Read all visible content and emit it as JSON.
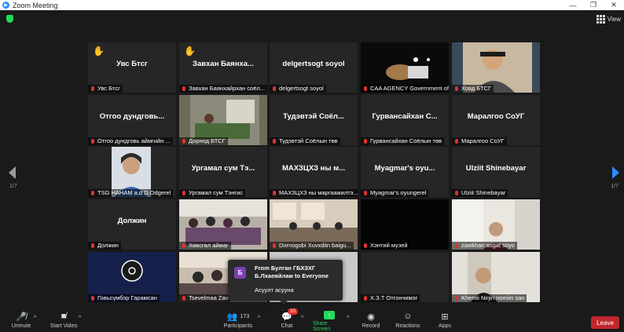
{
  "window": {
    "title": "Zoom Meeting",
    "view_label": "View"
  },
  "pager": {
    "left": "1/7",
    "right": "1/7"
  },
  "tiles": [
    {
      "name": "Увс Бтсг",
      "label": "Увс Бтсг",
      "hand": true
    },
    {
      "name": "Завхан Баянха...",
      "label": "Завхан Баянхайрхан соёл...",
      "hand": true
    },
    {
      "name": "delgertsogt soyol",
      "label": "delgertsogt soyol"
    },
    {
      "name": "",
      "label": "CAA AGENCY Government of ..."
    },
    {
      "name": "",
      "label": "Ховд БТСГ"
    },
    {
      "name": "Отгоо дундговь...",
      "label": "Отгоо дундговь аймгийн ..."
    },
    {
      "name": "",
      "label": "Дорнод БТСГ"
    },
    {
      "name": "Тудэвтэй Соёл...",
      "label": "Тудэвтэй Соёлын төв"
    },
    {
      "name": "Гурвансайхан С...",
      "label": "Гурвансайхан Соёлын төв"
    },
    {
      "name": "Маралгоо СоУГ",
      "label": "Маралгоо СоУГ"
    },
    {
      "name": "",
      "label": "TSG HAHAM a.d D.Odgerel"
    },
    {
      "name": "Ургамал сум Тэ...",
      "label": "Ургамал сум Тэнгис"
    },
    {
      "name": "МАХЗЦХЗ ны м...",
      "label": "МАХЗЦХЗ ны маргаажилтэ..."
    },
    {
      "name": "Myagmar's oyu...",
      "label": "Myagmar's oyungerel"
    },
    {
      "name": "Ulziit Shinebayar",
      "label": "Ulziit Shinebayar"
    },
    {
      "name": "Должин",
      "label": "Должин"
    },
    {
      "name": "",
      "label": "Хөвсгөл аймаг"
    },
    {
      "name": "",
      "label": "Dornogobi Xuvxdiin baigu..."
    },
    {
      "name": "",
      "label": "Хэнтий музей"
    },
    {
      "name": "",
      "label": "zawkhan asgat soyo"
    },
    {
      "name": "",
      "label": "Говьсүмбэр Гарамсан"
    },
    {
      "name": "",
      "label": "Tsevelmaa Zav"
    },
    {
      "name": "",
      "label": ""
    },
    {
      "name": "",
      "label": "Х.З.Т Отгончимэг"
    },
    {
      "name": "",
      "label": "Khentii Nirjin nomiin san"
    }
  ],
  "chat_popup": {
    "badge": "Б",
    "from": "From Булган ГБХЗХГ Б.Лхаевйлам to Everyone",
    "message": "Асуулт асууна"
  },
  "toolbar": {
    "unmute": "Unmute",
    "start_video": "Start Video",
    "participants": "Participants",
    "participants_count": "173",
    "chat": "Chat",
    "chat_badge": "10",
    "share_screen": "Share Screen",
    "record": "Record",
    "reactions": "Reactions",
    "apps": "Apps",
    "leave": "Leave"
  },
  "colors": {
    "accent": "#2d8cff",
    "active_border": "#d6f05c",
    "share": "#23d959",
    "leave": "#c0272d"
  }
}
